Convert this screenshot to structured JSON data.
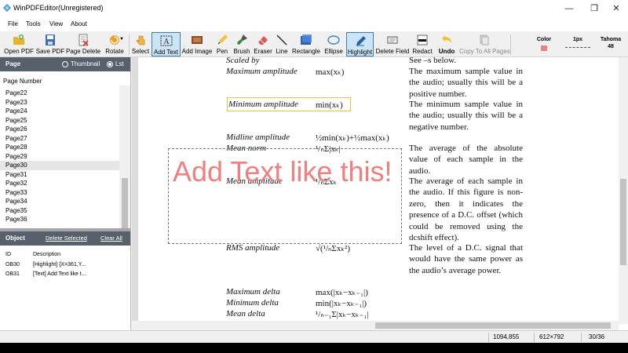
{
  "window": {
    "title": "WinPDFEditor(Unregistered)",
    "minimize_glyph": "—",
    "maximize_glyph": "❐",
    "close_glyph": "✕"
  },
  "menu": {
    "items": [
      "File",
      "Tools",
      "View",
      "About"
    ]
  },
  "toolbar": {
    "buttons": [
      {
        "label": "Open PDF",
        "icon": "open-pdf-icon"
      },
      {
        "label": "Save PDF",
        "icon": "save-icon"
      },
      {
        "label": "Page Delete",
        "icon": "page-delete-icon"
      },
      {
        "label": "Rotate",
        "icon": "rotate-icon"
      },
      {
        "label": "Select",
        "icon": "select-icon"
      },
      {
        "label": "Add Text",
        "icon": "add-text-icon"
      },
      {
        "label": "Add Image",
        "icon": "add-image-icon"
      },
      {
        "label": "Pen",
        "icon": "pen-icon"
      },
      {
        "label": "Brush",
        "icon": "brush-icon"
      },
      {
        "label": "Eraser",
        "icon": "eraser-icon"
      },
      {
        "label": "Line",
        "icon": "line-icon"
      },
      {
        "label": "Rectangle",
        "icon": "rectangle-icon"
      },
      {
        "label": "Ellipse",
        "icon": "ellipse-icon"
      },
      {
        "label": "Highlight",
        "icon": "highlight-icon"
      },
      {
        "label": "Delete Field",
        "icon": "delete-field-icon"
      },
      {
        "label": "Redact",
        "icon": "redact-icon"
      },
      {
        "label": "Undo",
        "icon": "undo-icon"
      },
      {
        "label": "Copy To All Pages",
        "icon": "copy-pages-icon"
      }
    ],
    "properties": {
      "color_label": "Color",
      "color_value": "#f08080",
      "size_label": "1px",
      "font_name": "Tahoma",
      "font_size": "48"
    }
  },
  "page_panel": {
    "title": "Page",
    "view_options": [
      {
        "label": "Thumbnail",
        "selected": false
      },
      {
        "label": "Lst",
        "selected": true
      }
    ],
    "list_header": "Page Number",
    "pages": [
      "Page22",
      "Page23",
      "Page24",
      "Page25",
      "Page26",
      "Page27",
      "Page28",
      "Page29",
      "Page30",
      "Page31",
      "Page32",
      "Page33",
      "Page34",
      "Page35",
      "Page36"
    ],
    "selected_page": "Page30"
  },
  "object_panel": {
    "title": "Object",
    "delete_selected": "Delete Selected",
    "clear_all": "Clear All",
    "columns": [
      "ID",
      "Description"
    ],
    "rows": [
      {
        "id": "OB30",
        "description": "[Highlight] {X=361,Y..."
      },
      {
        "id": "OB31",
        "description": "[Text] Add Text like t..."
      }
    ]
  },
  "document": {
    "terms": [
      {
        "term": "Scaled by",
        "formula": ""
      },
      {
        "term": "Maximum amplitude",
        "formula": "max(xₖ)"
      },
      {
        "term": "Minimum amplitude",
        "formula": "min(xₖ)"
      },
      {
        "term": "Midline amplitude",
        "formula": "½min(xₖ)+½max(xₖ)"
      },
      {
        "term": "Mean norm",
        "formula": "¹/ₙΣ|xₖ|"
      },
      {
        "term": "Mean amplitude",
        "formula": "¹/ₙΣxₖ"
      },
      {
        "term": "RMS amplitude",
        "formula": "√(¹/ₙΣxₖ²)"
      },
      {
        "term": "Maximum delta",
        "formula": "max(|xₖ−xₖ₋₁|)"
      },
      {
        "term": "Minimum delta",
        "formula": "min(|xₖ−xₖ₋₁|)"
      },
      {
        "term": "Mean delta",
        "formula": "¹/ₙ₋₁Σ|xₖ−xₖ₋₁|"
      }
    ],
    "descriptions": [
      "See –s below.",
      "The maximum sample value in the audio; usually this will be a positive number.",
      "The minimum sample value in the audio; usually this will be a negative number.",
      "The average of the absolute value of each sample in the audio.",
      "The average of each sample in the audio. If this figure is non-zero, then it indicates the presence of a D.C. offset (which could be removed using the dcshift effect).",
      "The level of a D.C. signal that would have the same power as the audio’s average power."
    ],
    "annotation_text": "Add Text like this!"
  },
  "status": {
    "coords": "1094,855",
    "page_size": "612×792",
    "page_index": "30/36"
  }
}
